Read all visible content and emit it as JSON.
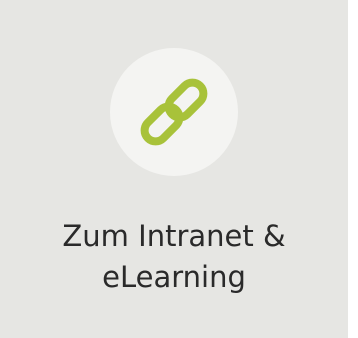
{
  "tile": {
    "label_line1": "Zum Intranet &",
    "label_line2": "eLearning",
    "icon": "link-icon",
    "accent_color": "#a8c23a",
    "background_color": "#e6e6e3",
    "circle_color": "#f4f4f2"
  }
}
